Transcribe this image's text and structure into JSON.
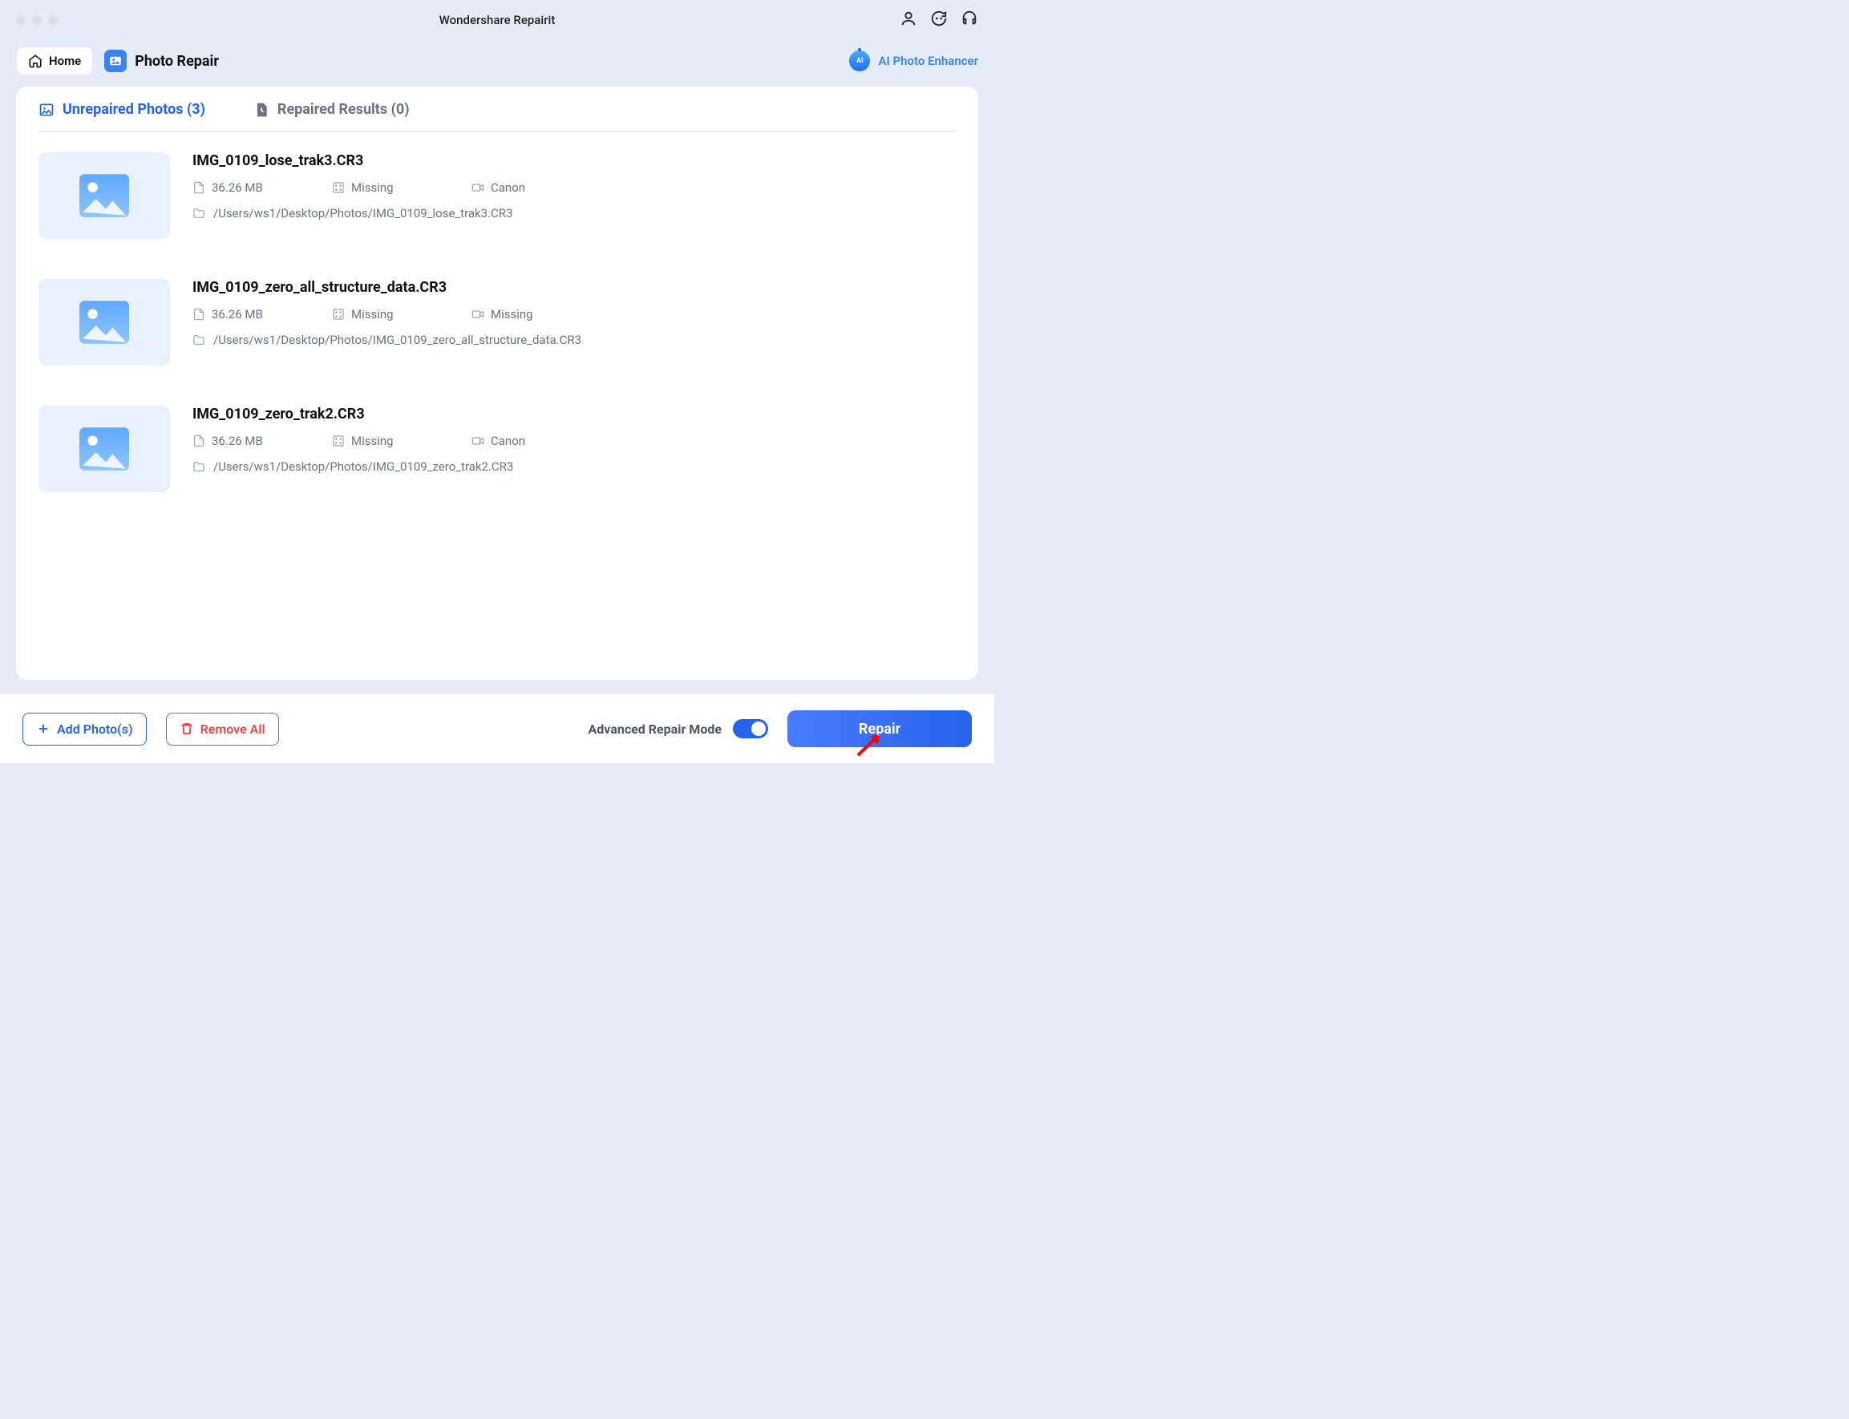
{
  "app": {
    "title": "Wondershare Repairit"
  },
  "nav": {
    "home": "Home",
    "module": "Photo Repair",
    "enhancer": "AI Photo Enhancer"
  },
  "tabs": {
    "unrepaired": {
      "label": "Unrepaired Photos",
      "count": "(3)"
    },
    "repaired": {
      "label": "Repaired Results",
      "count": "(0)"
    }
  },
  "photos": [
    {
      "name": "IMG_0109_lose_trak3.CR3",
      "size": "36.26 MB",
      "resolution": "Missing",
      "device": "Canon",
      "path": "/Users/ws1/Desktop/Photos/IMG_0109_lose_trak3.CR3"
    },
    {
      "name": "IMG_0109_zero_all_structure_data.CR3",
      "size": "36.26 MB",
      "resolution": "Missing",
      "device": "Missing",
      "path": "/Users/ws1/Desktop/Photos/IMG_0109_zero_all_structure_data.CR3"
    },
    {
      "name": "IMG_0109_zero_trak2.CR3",
      "size": "36.26 MB",
      "resolution": "Missing",
      "device": "Canon",
      "path": "/Users/ws1/Desktop/Photos/IMG_0109_zero_trak2.CR3"
    }
  ],
  "footer": {
    "add": "Add Photo(s)",
    "remove": "Remove All",
    "advanced": "Advanced Repair Mode",
    "repair": "Repair"
  }
}
